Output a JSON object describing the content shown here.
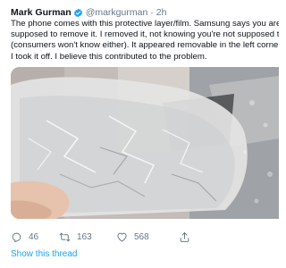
{
  "author": {
    "name": "Mark Gurman",
    "handle": "@markgurman",
    "separator": "·",
    "time": "2h",
    "verified_icon": "verified-badge-icon"
  },
  "tweet_lines": [
    "The phone comes with this protective layer/film. Samsung says you are not",
    "supposed to remove it. I removed it, not knowing you're not supposed to",
    "(consumers won't know either). It appeared removable in the left corner so",
    "I took it off. I believe this contributed to the problem."
  ],
  "actions": {
    "reply": {
      "icon": "reply-icon",
      "count": "46"
    },
    "retweet": {
      "icon": "retweet-icon",
      "count": "163"
    },
    "like": {
      "icon": "heart-icon",
      "count": "568"
    },
    "share": {
      "icon": "share-icon"
    }
  },
  "show_thread": "Show this thread",
  "colors": {
    "link": "#1da1f2",
    "secondary": "#657786",
    "text": "#0f1419",
    "verified": "#1da1f2"
  }
}
